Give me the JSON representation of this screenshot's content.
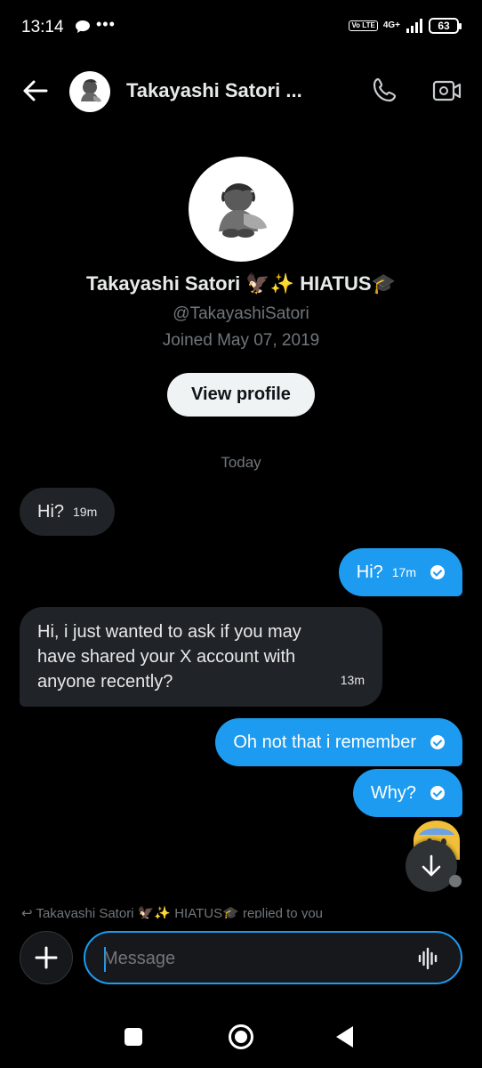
{
  "status_bar": {
    "time": "13:14",
    "dots": "•••",
    "volte": "Vo LTE",
    "network": "4G+",
    "battery": "63"
  },
  "header": {
    "title": "Takayashi Satori ...",
    "back_icon": "arrow-left-icon",
    "call_icon": "phone-icon",
    "video_icon": "video-camera-icon"
  },
  "profile": {
    "name": "Takayashi Satori 🦅✨ HIATUS🎓",
    "handle": "@TakayashiSatori",
    "joined": "Joined May 07, 2019",
    "view_profile_label": "View profile"
  },
  "date_separator": "Today",
  "messages": [
    {
      "direction": "incoming",
      "text": "Hi?",
      "time": "19m"
    },
    {
      "direction": "outgoing",
      "text": "Hi?",
      "time": "17m",
      "status": "read"
    },
    {
      "direction": "incoming",
      "text": "Hi, i just wanted to ask if you may have shared your X account with anyone recently?",
      "time": "13m"
    },
    {
      "direction": "outgoing",
      "text": "Oh not that i remember",
      "time": "",
      "status": "read"
    },
    {
      "direction": "outgoing",
      "text": "Why?",
      "time": "",
      "status": "read"
    }
  ],
  "reply_preview": "↩ Takayashi Satori 🦅✨ HIATUS🎓 replied to you",
  "compose": {
    "placeholder": "Message",
    "add_icon": "plus-icon",
    "voice_icon": "voice-wave-icon"
  },
  "colors": {
    "accent": "#1d9bf0",
    "background": "#000000",
    "incoming_bubble": "#202327",
    "muted_text": "#71767b"
  }
}
